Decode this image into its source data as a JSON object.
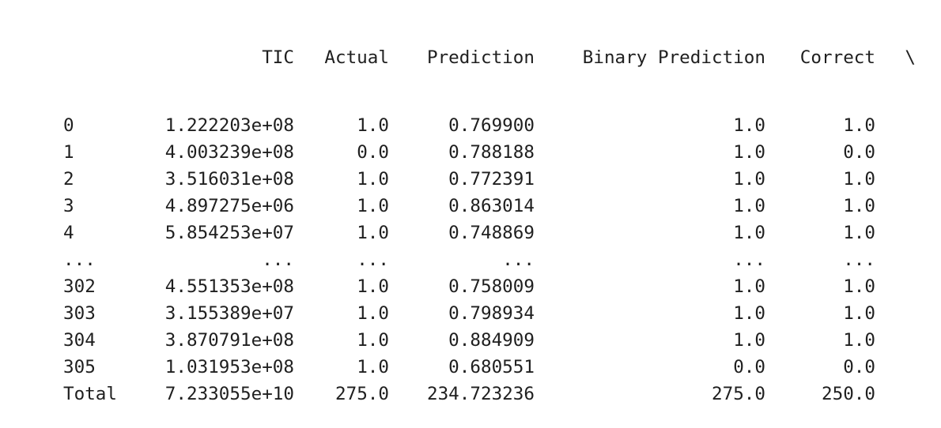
{
  "dataframe": {
    "columns": [
      "TIC",
      "Actual",
      "Prediction",
      "Binary Prediction",
      "Correct"
    ],
    "continuation_marker": "\\",
    "rows": [
      {
        "index": "0",
        "tic": "1.222203e+08",
        "actual": "1.0",
        "prediction": "0.769900",
        "binary_prediction": "1.0",
        "correct": "1.0"
      },
      {
        "index": "1",
        "tic": "4.003239e+08",
        "actual": "0.0",
        "prediction": "0.788188",
        "binary_prediction": "1.0",
        "correct": "0.0"
      },
      {
        "index": "2",
        "tic": "3.516031e+08",
        "actual": "1.0",
        "prediction": "0.772391",
        "binary_prediction": "1.0",
        "correct": "1.0"
      },
      {
        "index": "3",
        "tic": "4.897275e+06",
        "actual": "1.0",
        "prediction": "0.863014",
        "binary_prediction": "1.0",
        "correct": "1.0"
      },
      {
        "index": "4",
        "tic": "5.854253e+07",
        "actual": "1.0",
        "prediction": "0.748869",
        "binary_prediction": "1.0",
        "correct": "1.0"
      },
      {
        "index": "...",
        "tic": "...",
        "actual": "...",
        "prediction": "...",
        "binary_prediction": "...",
        "correct": "..."
      },
      {
        "index": "302",
        "tic": "4.551353e+08",
        "actual": "1.0",
        "prediction": "0.758009",
        "binary_prediction": "1.0",
        "correct": "1.0"
      },
      {
        "index": "303",
        "tic": "3.155389e+07",
        "actual": "1.0",
        "prediction": "0.798934",
        "binary_prediction": "1.0",
        "correct": "1.0"
      },
      {
        "index": "304",
        "tic": "3.870791e+08",
        "actual": "1.0",
        "prediction": "0.884909",
        "binary_prediction": "1.0",
        "correct": "1.0"
      },
      {
        "index": "305",
        "tic": "1.031953e+08",
        "actual": "1.0",
        "prediction": "0.680551",
        "binary_prediction": "0.0",
        "correct": "0.0"
      },
      {
        "index": "Total",
        "tic": "7.233055e+10",
        "actual": "275.0",
        "prediction": "234.723236",
        "binary_prediction": "275.0",
        "correct": "250.0"
      }
    ]
  }
}
